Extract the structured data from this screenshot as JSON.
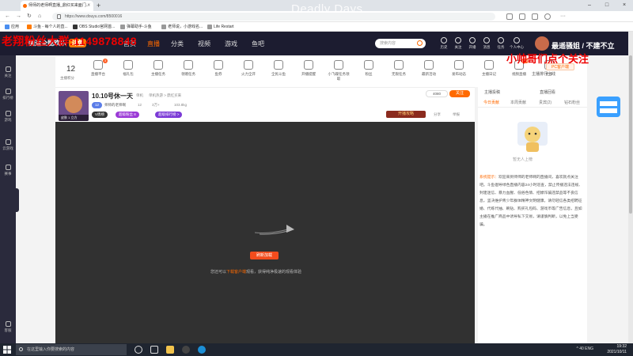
{
  "browser": {
    "tab_title": "师师的老师啊直播_鼎红买来面门...",
    "url": "https://www.douyu.com/8500016",
    "overlay_title": "Deadly Days",
    "bookmarks": [
      "应用",
      "斗鱼 - 每个人的直...",
      "OBS Studio官网首...",
      "弹幕助手-斗鱼",
      "老师说，小游戏名...",
      "Life Restart"
    ]
  },
  "site": {
    "logo_text": "国运全能欢乐",
    "logo_badge": "斗鱼",
    "nav": [
      "首页",
      "直播",
      "分类",
      "视频",
      "游戏",
      "鱼吧"
    ],
    "search_placeholder": "搜索内容",
    "header_icons": [
      "历史",
      "关注",
      "开播",
      "消息",
      "任务",
      "个人中心"
    ],
    "user_name": "最遥骚姐 / 不建不立",
    "overlay_qq": "老翔粉丝大群:1149878848",
    "overlay_follow": "小帅哥们点个关注"
  },
  "sidebar": [
    "关注",
    "排行榜",
    "游戏",
    "云游戏",
    "赛事",
    "客服"
  ],
  "tasks": {
    "level": "12",
    "level_label": "主播积分",
    "items": [
      {
        "label": "直播平台",
        "badge": "3"
      },
      {
        "label": "福礼包",
        "badge": ""
      },
      {
        "label": "主播任务",
        "badge": ""
      },
      {
        "label": "领赠任务",
        "badge": ""
      },
      {
        "label": "鱼券",
        "badge": ""
      },
      {
        "label": "火力全开",
        "badge": ""
      },
      {
        "label": "全民斗鱼",
        "badge": ""
      },
      {
        "label": "开播提醒",
        "badge": ""
      },
      {
        "label": "小飞碟任务领取",
        "badge": ""
      },
      {
        "label": "粉丝",
        "badge": ""
      },
      {
        "label": "无限任务",
        "badge": ""
      },
      {
        "label": "最新活动",
        "badge": ""
      },
      {
        "label": "发布动态",
        "badge": ""
      },
      {
        "label": "主播日记",
        "badge": ""
      },
      {
        "label": "视频直播",
        "badge": "NEW"
      },
      {
        "label": "更多",
        "badge": ""
      }
    ],
    "rank_label": "主播排行上线"
  },
  "room": {
    "title": "10.10号休一天",
    "category": "单机",
    "cat2": "单机热游 > 鼎红买来",
    "anchor": "师师的老师啊",
    "level": "12",
    "followers": "3万+",
    "weight": "103.8kg",
    "avatar_caption": "皮肤 1 立方",
    "vip_badge": "V周榜",
    "pill1": "超级粉丝",
    "pill1_num": "8",
    "pill2": "超级排行榜 >",
    "fans_count": "4080",
    "follow_label": "关注",
    "dance_label": "开播攻略",
    "share": "分享",
    "report": "举报"
  },
  "video": {
    "reload_label": "刷新加载",
    "hint_pre": "您还可以",
    "hint_link": "下载客户端",
    "hint_post": "观看，获得纯净极速的观看体验"
  },
  "right": {
    "heading1": "主播投稿",
    "heading2": "直播回看",
    "pc_client": "PC客户端",
    "tabs": [
      "今日贡献",
      "本周贡献",
      "贵宾(2)",
      "钻石粉丝"
    ],
    "empty_text": "暂无人上榜",
    "sys_tag": "系统提示：",
    "sys_msg": "欢迎来到师师的老师啊的直播间，喜欢就点关注吧。斗鱼倡导绿色直播内容24小时巡查，禁止传播违法违规、封建迷信、暴力血腥、低俗色情、招嫖诈骗违禁品等不良信息，坚决维护青少年群体精神文明健康。请勿轻信各类招聘征婚、代练代抽、刷钻、购买礼包码、游戏币等广告信息，且如主播在推广商品中诱导私下交易，请谨慎判断，以免上当受骗。"
  },
  "taskbar": {
    "search_placeholder": "在这里输入你要搜索的内容",
    "time": "19:32",
    "date": "2021/10/11",
    "tray": "^ 40 ENG"
  },
  "colors": {
    "accent": "#ff6a00",
    "header_bg": "#1c1c30",
    "video_bg": "#313131",
    "overlay_red": "#ee0000"
  }
}
